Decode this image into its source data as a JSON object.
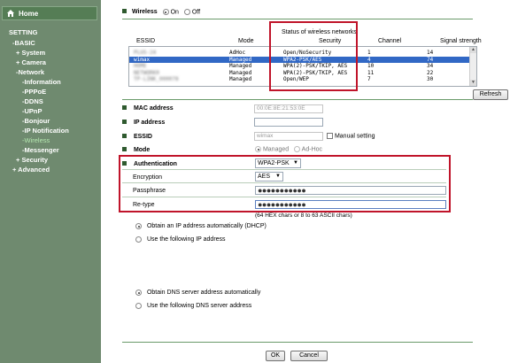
{
  "sidebar": {
    "home": "Home",
    "menu_title": "SETTING",
    "items": [
      {
        "label": "-BASIC"
      },
      {
        "label": "+ System"
      },
      {
        "label": "+ Camera"
      },
      {
        "label": "-Network"
      },
      {
        "label": "-Information"
      },
      {
        "label": "-PPPoE"
      },
      {
        "label": "-DDNS"
      },
      {
        "label": "-UPnP"
      },
      {
        "label": "-Bonjour"
      },
      {
        "label": "-IP Notification"
      },
      {
        "label": "-Wireless"
      },
      {
        "label": "-Messenger"
      },
      {
        "label": "+ Security"
      },
      {
        "label": "+ Advanced"
      }
    ]
  },
  "wireless": {
    "label": "Wireless",
    "on": "On",
    "off": "Off",
    "status_title": "Status of wireless networks",
    "columns": [
      "ESSID",
      "Mode",
      "Security",
      "Channel",
      "Signal strength"
    ],
    "rows": [
      {
        "essid": "PLUS-24",
        "essid_redacted": true,
        "mode": "AdHoc",
        "security": "Open/NoSecurity",
        "channel": "1",
        "signal": "14",
        "selected": false
      },
      {
        "essid": "wimax",
        "essid_redacted": false,
        "mode": "Managed",
        "security": "WPA2-PSK/AES",
        "channel": "4",
        "signal": "74",
        "selected": true
      },
      {
        "essid": "HOME",
        "essid_redacted": true,
        "mode": "Managed",
        "security": "WPA(2)-PSK/TKIP, AES",
        "channel": "10",
        "signal": "34",
        "selected": false
      },
      {
        "essid": "NETWORK0",
        "essid_redacted": true,
        "mode": "Managed",
        "security": "WPA(2)-PSK/TKIP, AES",
        "channel": "11",
        "signal": "22",
        "selected": false
      },
      {
        "essid": "TP-LINK_000078",
        "essid_redacted": true,
        "mode": "Managed",
        "security": "Open/WEP",
        "channel": "7",
        "signal": "30",
        "selected": false
      }
    ],
    "refresh": "Refresh"
  },
  "fields": {
    "mac_label": "MAC address",
    "mac_value": "00:0E:8E:21:53:0E",
    "ip_label": "IP address",
    "ip_value": "",
    "essid_label": "ESSID",
    "essid_value": "wimax",
    "manual_setting": "Manual setting",
    "mode_label": "Mode",
    "mode_managed": "Managed",
    "mode_adhoc": "Ad-Hoc"
  },
  "auth": {
    "label": "Authentication",
    "value": "WPA2-PSK",
    "encryption_label": "Encryption",
    "encryption_value": "AES",
    "passphrase_label": "Passphrase",
    "passphrase_value": "●●●●●●●●●●●",
    "retype_label": "Re-type",
    "retype_value": "●●●●●●●●●●●",
    "hint": "(64 HEX chars or 8 to 63 ASCII chars)"
  },
  "ip": {
    "dhcp": "Obtain an IP address automatically (DHCP)",
    "manual": "Use the following IP address"
  },
  "dns": {
    "auto": "Obtain DNS server address automatically",
    "manual": "Use the following DNS server address"
  },
  "footer": {
    "ok": "OK",
    "cancel": "Cancel"
  },
  "colors": {
    "sidebar_bg": "#6f8a6f",
    "accent_green": "#2f5a2f",
    "highlight": "#c0142a",
    "selection": "#3168c5"
  }
}
